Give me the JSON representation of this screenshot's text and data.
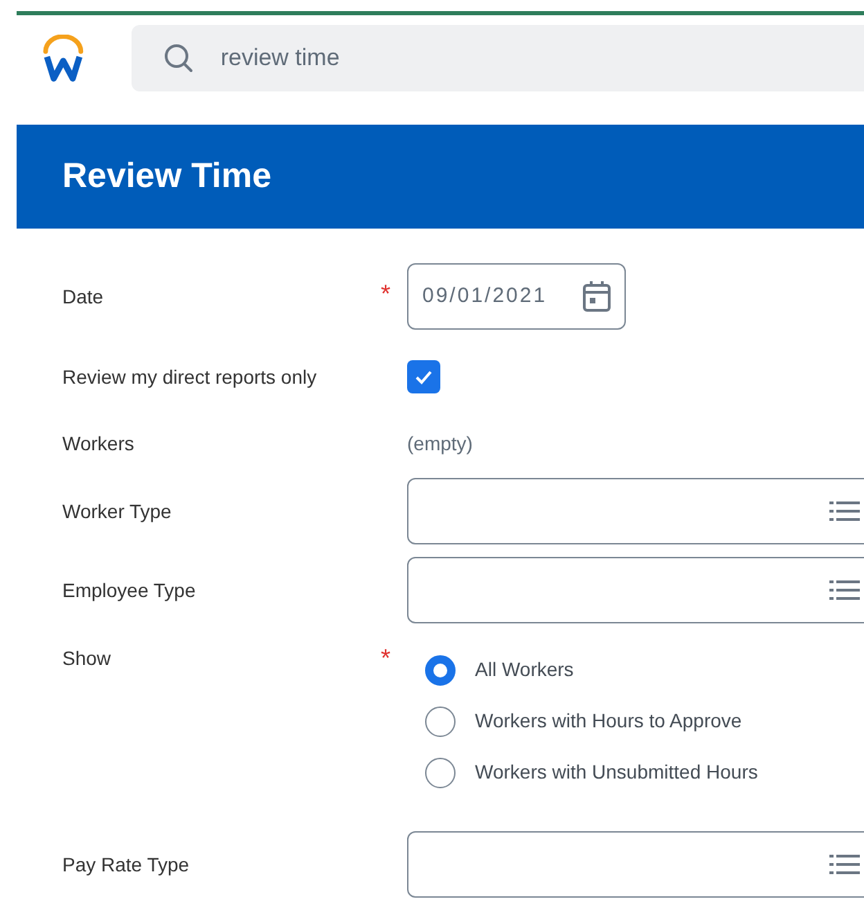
{
  "search": {
    "value": "review time"
  },
  "header": {
    "title": "Review Time"
  },
  "form": {
    "rows": [
      {
        "kind": "date",
        "label": "Date",
        "required_mark": "*",
        "value": "09/01/2021"
      },
      {
        "kind": "checkbox",
        "label": "Review my direct reports only",
        "checked": true
      },
      {
        "kind": "readonly",
        "label": "Workers",
        "value": "(empty)"
      },
      {
        "kind": "prompt",
        "label": "Worker Type"
      },
      {
        "kind": "prompt",
        "label": "Employee Type"
      },
      {
        "kind": "radio",
        "label": "Show",
        "required_mark": "*",
        "options": [
          {
            "label": "All Workers",
            "selected": true
          },
          {
            "label": "Workers with Hours to Approve",
            "selected": false
          },
          {
            "label": "Workers with Unsubmitted Hours",
            "selected": false
          }
        ]
      },
      {
        "kind": "prompt",
        "label": "Pay Rate Type"
      }
    ]
  }
}
